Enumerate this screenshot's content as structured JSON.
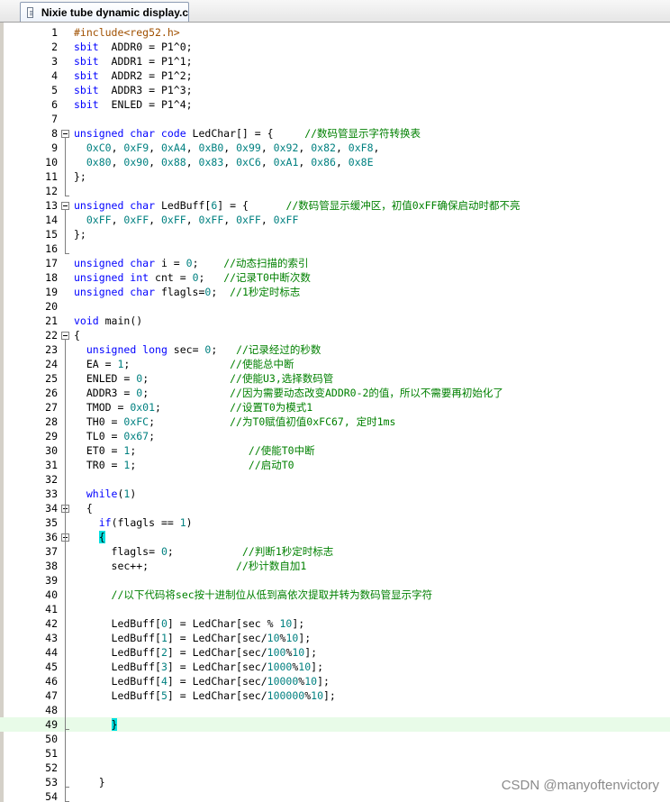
{
  "tab": {
    "title": "Nixie tube dynamic display.c"
  },
  "watermark": "CSDN @manyoftenvictory",
  "lines": [
    {
      "n": "1",
      "tokens": [
        [
          "pp",
          "#include<reg52.h>"
        ]
      ]
    },
    {
      "n": "2",
      "tokens": [
        [
          "kw",
          "sbit"
        ],
        [
          "",
          "  ADDR0 = P1^0;"
        ]
      ]
    },
    {
      "n": "3",
      "tokens": [
        [
          "kw",
          "sbit"
        ],
        [
          "",
          "  ADDR1 = P1^1;"
        ]
      ]
    },
    {
      "n": "4",
      "tokens": [
        [
          "kw",
          "sbit"
        ],
        [
          "",
          "  ADDR2 = P1^2;"
        ]
      ]
    },
    {
      "n": "5",
      "tokens": [
        [
          "kw",
          "sbit"
        ],
        [
          "",
          "  ADDR3 = P1^3;"
        ]
      ]
    },
    {
      "n": "6",
      "tokens": [
        [
          "kw",
          "sbit"
        ],
        [
          "",
          "  ENLED = P1^4;"
        ]
      ]
    },
    {
      "n": "7",
      "tokens": []
    },
    {
      "n": "8",
      "fold": true,
      "tokens": [
        [
          "kw",
          "unsigned char code"
        ],
        [
          "",
          " LedChar[] = {     "
        ],
        [
          "cmt",
          "//数码管显示字符转换表"
        ]
      ]
    },
    {
      "n": "9",
      "tokens": [
        [
          "",
          "  "
        ],
        [
          "num",
          "0xC0"
        ],
        [
          "",
          ", "
        ],
        [
          "num",
          "0xF9"
        ],
        [
          "",
          ", "
        ],
        [
          "num",
          "0xA4"
        ],
        [
          "",
          ", "
        ],
        [
          "num",
          "0xB0"
        ],
        [
          "",
          ", "
        ],
        [
          "num",
          "0x99"
        ],
        [
          "",
          ", "
        ],
        [
          "num",
          "0x92"
        ],
        [
          "",
          ", "
        ],
        [
          "num",
          "0x82"
        ],
        [
          "",
          ", "
        ],
        [
          "num",
          "0xF8"
        ],
        [
          "",
          ","
        ]
      ]
    },
    {
      "n": "10",
      "tokens": [
        [
          "",
          "  "
        ],
        [
          "num",
          "0x80"
        ],
        [
          "",
          ", "
        ],
        [
          "num",
          "0x90"
        ],
        [
          "",
          ", "
        ],
        [
          "num",
          "0x88"
        ],
        [
          "",
          ", "
        ],
        [
          "num",
          "0x83"
        ],
        [
          "",
          ", "
        ],
        [
          "num",
          "0xC6"
        ],
        [
          "",
          ", "
        ],
        [
          "num",
          "0xA1"
        ],
        [
          "",
          ", "
        ],
        [
          "num",
          "0x86"
        ],
        [
          "",
          ", "
        ],
        [
          "num",
          "0x8E"
        ]
      ]
    },
    {
      "n": "11",
      "tokens": [
        [
          "",
          "};"
        ]
      ]
    },
    {
      "n": "12",
      "tokens": []
    },
    {
      "n": "13",
      "fold": true,
      "tokens": [
        [
          "kw",
          "unsigned char"
        ],
        [
          "",
          " LedBuff["
        ],
        [
          "num",
          "6"
        ],
        [
          "",
          "] = {      "
        ],
        [
          "cmt",
          "//数码管显示缓冲区，初值0xFF确保启动时都不亮"
        ]
      ]
    },
    {
      "n": "14",
      "tokens": [
        [
          "",
          "  "
        ],
        [
          "num",
          "0xFF"
        ],
        [
          "",
          ", "
        ],
        [
          "num",
          "0xFF"
        ],
        [
          "",
          ", "
        ],
        [
          "num",
          "0xFF"
        ],
        [
          "",
          ", "
        ],
        [
          "num",
          "0xFF"
        ],
        [
          "",
          ", "
        ],
        [
          "num",
          "0xFF"
        ],
        [
          "",
          ", "
        ],
        [
          "num",
          "0xFF"
        ]
      ]
    },
    {
      "n": "15",
      "tokens": [
        [
          "",
          "};"
        ]
      ]
    },
    {
      "n": "16",
      "tokens": []
    },
    {
      "n": "17",
      "tokens": [
        [
          "kw",
          "unsigned char"
        ],
        [
          "",
          " i = "
        ],
        [
          "num",
          "0"
        ],
        [
          "",
          ";    "
        ],
        [
          "cmt",
          "//动态扫描的索引"
        ]
      ]
    },
    {
      "n": "18",
      "tokens": [
        [
          "kw",
          "unsigned int"
        ],
        [
          "",
          " cnt = "
        ],
        [
          "num",
          "0"
        ],
        [
          "",
          ";   "
        ],
        [
          "cmt",
          "//记录T0中断次数"
        ]
      ]
    },
    {
      "n": "19",
      "tokens": [
        [
          "kw",
          "unsigned char"
        ],
        [
          "",
          " flagls="
        ],
        [
          "num",
          "0"
        ],
        [
          "",
          ";  "
        ],
        [
          "cmt",
          "//1秒定时标志"
        ]
      ]
    },
    {
      "n": "20",
      "tokens": []
    },
    {
      "n": "21",
      "tokens": [
        [
          "kw",
          "void"
        ],
        [
          "",
          " main()"
        ]
      ]
    },
    {
      "n": "22",
      "fold": true,
      "tokens": [
        [
          "",
          "{"
        ]
      ]
    },
    {
      "n": "23",
      "tokens": [
        [
          "",
          "  "
        ],
        [
          "kw",
          "unsigned long"
        ],
        [
          "",
          " sec= "
        ],
        [
          "num",
          "0"
        ],
        [
          "",
          ";   "
        ],
        [
          "cmt",
          "//记录经过的秒数"
        ]
      ]
    },
    {
      "n": "24",
      "tokens": [
        [
          "",
          "  EA = "
        ],
        [
          "num",
          "1"
        ],
        [
          "",
          ";                "
        ],
        [
          "cmt",
          "//使能总中断"
        ]
      ]
    },
    {
      "n": "25",
      "tokens": [
        [
          "",
          "  ENLED = "
        ],
        [
          "num",
          "0"
        ],
        [
          "",
          ";             "
        ],
        [
          "cmt",
          "//使能U3,选择数码管"
        ]
      ]
    },
    {
      "n": "26",
      "tokens": [
        [
          "",
          "  ADDR3 = "
        ],
        [
          "num",
          "0"
        ],
        [
          "",
          ";             "
        ],
        [
          "cmt",
          "//因为需要动态改变ADDR0-2的值，所以不需要再初始化了"
        ]
      ]
    },
    {
      "n": "27",
      "tokens": [
        [
          "",
          "  TMOD = "
        ],
        [
          "num",
          "0x01"
        ],
        [
          "",
          ";           "
        ],
        [
          "cmt",
          "//设置T0为模式1"
        ]
      ]
    },
    {
      "n": "28",
      "tokens": [
        [
          "",
          "  TH0 = "
        ],
        [
          "num",
          "0xFC"
        ],
        [
          "",
          ";            "
        ],
        [
          "cmt",
          "//为T0赋值初值0xFC67, 定时1ms"
        ]
      ]
    },
    {
      "n": "29",
      "tokens": [
        [
          "",
          "  TL0 = "
        ],
        [
          "num",
          "0x67"
        ],
        [
          "",
          ";"
        ]
      ]
    },
    {
      "n": "30",
      "tokens": [
        [
          "",
          "  ET0 = "
        ],
        [
          "num",
          "1"
        ],
        [
          "",
          ";                  "
        ],
        [
          "cmt",
          "//使能T0中断"
        ]
      ]
    },
    {
      "n": "31",
      "tokens": [
        [
          "",
          "  TR0 = "
        ],
        [
          "num",
          "1"
        ],
        [
          "",
          ";                  "
        ],
        [
          "cmt",
          "//启动T0"
        ]
      ]
    },
    {
      "n": "32",
      "tokens": []
    },
    {
      "n": "33",
      "tokens": [
        [
          "",
          "  "
        ],
        [
          "kw",
          "while"
        ],
        [
          "",
          "("
        ],
        [
          "num",
          "1"
        ],
        [
          "",
          ")"
        ]
      ]
    },
    {
      "n": "34",
      "fold": true,
      "tokens": [
        [
          "",
          "  {"
        ]
      ]
    },
    {
      "n": "35",
      "tokens": [
        [
          "",
          "    "
        ],
        [
          "kw",
          "if"
        ],
        [
          "",
          "(flagls == "
        ],
        [
          "num",
          "1"
        ],
        [
          "",
          ")"
        ]
      ]
    },
    {
      "n": "36",
      "fold": true,
      "tokens": [
        [
          "",
          "    "
        ],
        [
          "hl",
          "{"
        ]
      ]
    },
    {
      "n": "37",
      "tokens": [
        [
          "",
          "      flagls= "
        ],
        [
          "num",
          "0"
        ],
        [
          "",
          ";           "
        ],
        [
          "cmt",
          "//判断1秒定时标志"
        ]
      ]
    },
    {
      "n": "38",
      "tokens": [
        [
          "",
          "      sec++;              "
        ],
        [
          "cmt",
          "//秒计数自加1"
        ]
      ]
    },
    {
      "n": "39",
      "tokens": []
    },
    {
      "n": "40",
      "tokens": [
        [
          "",
          "      "
        ],
        [
          "cmt",
          "//以下代码将sec按十进制位从低到高依次提取并转为数码管显示字符"
        ]
      ]
    },
    {
      "n": "41",
      "tokens": []
    },
    {
      "n": "42",
      "tokens": [
        [
          "",
          "      LedBuff["
        ],
        [
          "num",
          "0"
        ],
        [
          "",
          "] = LedChar[sec % "
        ],
        [
          "num",
          "10"
        ],
        [
          "",
          "];"
        ]
      ]
    },
    {
      "n": "43",
      "tokens": [
        [
          "",
          "      LedBuff["
        ],
        [
          "num",
          "1"
        ],
        [
          "",
          "] = LedChar[sec/"
        ],
        [
          "num",
          "10"
        ],
        [
          "",
          "%"
        ],
        [
          "num",
          "10"
        ],
        [
          "",
          "];"
        ]
      ]
    },
    {
      "n": "44",
      "tokens": [
        [
          "",
          "      LedBuff["
        ],
        [
          "num",
          "2"
        ],
        [
          "",
          "] = LedChar[sec/"
        ],
        [
          "num",
          "100"
        ],
        [
          "",
          "%"
        ],
        [
          "num",
          "10"
        ],
        [
          "",
          "];"
        ]
      ]
    },
    {
      "n": "45",
      "tokens": [
        [
          "",
          "      LedBuff["
        ],
        [
          "num",
          "3"
        ],
        [
          "",
          "] = LedChar[sec/"
        ],
        [
          "num",
          "1000"
        ],
        [
          "",
          "%"
        ],
        [
          "num",
          "10"
        ],
        [
          "",
          "];"
        ]
      ]
    },
    {
      "n": "46",
      "tokens": [
        [
          "",
          "      LedBuff["
        ],
        [
          "num",
          "4"
        ],
        [
          "",
          "] = LedChar[sec/"
        ],
        [
          "num",
          "10000"
        ],
        [
          "",
          "%"
        ],
        [
          "num",
          "10"
        ],
        [
          "",
          "];"
        ]
      ]
    },
    {
      "n": "47",
      "tokens": [
        [
          "",
          "      LedBuff["
        ],
        [
          "num",
          "5"
        ],
        [
          "",
          "] = LedChar[sec/"
        ],
        [
          "num",
          "100000"
        ],
        [
          "",
          "%"
        ],
        [
          "num",
          "10"
        ],
        [
          "",
          "];"
        ]
      ]
    },
    {
      "n": "48",
      "tokens": []
    },
    {
      "n": "49",
      "current": true,
      "tokens": [
        [
          "",
          "      "
        ],
        [
          "hl",
          "}"
        ]
      ]
    },
    {
      "n": "50",
      "tokens": []
    },
    {
      "n": "51",
      "tokens": []
    },
    {
      "n": "52",
      "tokens": []
    },
    {
      "n": "53",
      "tokens": [
        [
          "",
          "    }"
        ]
      ]
    },
    {
      "n": "54",
      "tokens": []
    }
  ]
}
